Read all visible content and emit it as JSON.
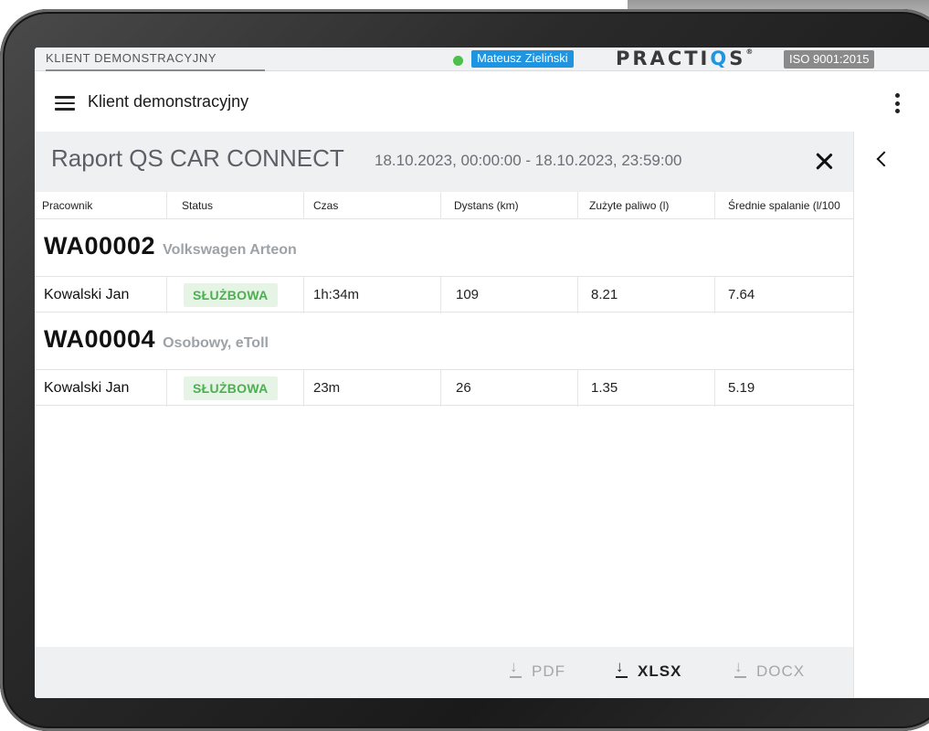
{
  "topbar": {
    "client_tab": "KLIENT DEMONSTRACYJNY",
    "status_color": "#4cc04a",
    "user_name": "Mateusz Zieliński",
    "brand": "PRACTIQS",
    "iso_badge": "ISO 9001:2015"
  },
  "appbar": {
    "title": "Klient demonstracyjny",
    "menu_icon": "hamburger-menu-icon",
    "more_icon": "kebab-menu-icon"
  },
  "report": {
    "title": "Raport QS CAR CONNECT",
    "date_range": "18.10.2023, 00:00:00 - 18.10.2023, 23:59:00",
    "close_icon": "close-icon",
    "columns": [
      "Pracownik",
      "Status",
      "Czas",
      "Dystans (km)",
      "Zużyte paliwo (l)",
      "Średnie spalanie (l/100"
    ],
    "groups": [
      {
        "vehicle": "WA00002",
        "description": "Volkswagen Arteon",
        "rows": [
          {
            "employee": "Kowalski Jan",
            "status": "SŁUŻBOWA",
            "time": "1h:34m",
            "distance": "109",
            "fuel": "8.21",
            "avg": "7.64"
          }
        ]
      },
      {
        "vehicle": "WA00004",
        "description": "Osobowy, eToll",
        "rows": [
          {
            "employee": "Kowalski Jan",
            "status": "SŁUŻBOWA",
            "time": "23m",
            "distance": "26",
            "fuel": "1.35",
            "avg": "5.19"
          }
        ]
      }
    ],
    "exports": [
      {
        "label": "PDF",
        "enabled": false
      },
      {
        "label": "XLSX",
        "enabled": true
      },
      {
        "label": "DOCX",
        "enabled": false
      }
    ]
  },
  "side_panel": {
    "toggle_icon": "chevron-left-icon"
  },
  "colors": {
    "accent": "#1f94e0",
    "status_ok_bg": "#e6f4e6",
    "status_ok_fg": "#4caf50"
  }
}
